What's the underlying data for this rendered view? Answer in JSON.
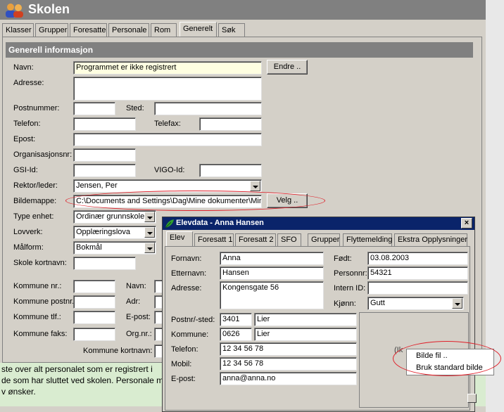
{
  "app": {
    "title": "Skolen",
    "tabs": [
      "Klasser",
      "Grupper",
      "Foresatte",
      "Personale",
      "Rom",
      "Generelt",
      "Søk"
    ],
    "active_tab": "Generelt"
  },
  "section_title": "Generell informasjon",
  "form": {
    "navn_label": "Navn:",
    "navn_value": "Programmet er ikke registrert",
    "endre_label": "Endre ..",
    "adresse_label": "Adresse:",
    "postnummer_label": "Postnummer:",
    "sted_label": "Sted:",
    "telefon_label": "Telefon:",
    "telefax_label": "Telefax:",
    "epost_label": "Epost:",
    "orgnr_label": "Organisasjonsnr:",
    "gsi_label": "GSI-Id:",
    "vigo_label": "VIGO-Id:",
    "rektor_label": "Rektor/leder:",
    "rektor_value": "Jensen, Per",
    "bildemappe_label": "Bildemappe:",
    "bildemappe_value": "C:\\Documents and Settings\\Dag\\Mine dokumenter\\Min",
    "velg_label": "Velg ..",
    "type_label": "Type enhet:",
    "type_value": "Ordinær grunnskole",
    "lovverk_label": "Lovverk:",
    "lovverk_value": "Opplæringslova",
    "malform_label": "Målform:",
    "malform_value": "Bokmål",
    "skole_kortnavn_label": "Skole kortnavn:",
    "kommune_nr_label": "Kommune nr.:",
    "navn2_label": "Navn:",
    "kommune_postnr_label": "Kommune postnr.:",
    "adr_label": "Adr:",
    "kommune_tlf_label": "Kommune tlf.:",
    "epost2_label": "E-post:",
    "kommune_faks_label": "Kommune faks:",
    "orgnr2_label": "Org.nr.:",
    "kommune_kortnavn_label": "Kommune kortnavn:"
  },
  "status": {
    "line1": "ste over alt personalet som er registrert i",
    "line2": "de som har sluttet ved skolen. Personale må legges inn med initialer. I Kode-feltet kan du legge inn ansattnr. eller",
    "line3": "v ønsker."
  },
  "dialog": {
    "title": "Elevdata - Anna Hansen",
    "tabs": [
      "Elev",
      "Foresatt 1",
      "Foresatt 2",
      "SFO",
      "Grupper",
      "Flyttemelding",
      "Ekstra Opplysninger"
    ],
    "active_tab": "Elev",
    "fornavn_label": "Fornavn:",
    "fornavn_value": "Anna",
    "etternavn_label": "Etternavn:",
    "etternavn_value": "Hansen",
    "adresse_label": "Adresse:",
    "adresse_value": "Kongensgate 56",
    "postnr_label": "Postnr/-sted:",
    "postnr_value": "3401",
    "sted_value": "Lier",
    "kommune_label": "Kommune:",
    "kommune_nr_value": "0626",
    "kommune_value": "Lier",
    "telefon_label": "Telefon:",
    "telefon_value": "12 34 56 78",
    "mobil_label": "Mobil:",
    "mobil_value": "12 34 56 78",
    "epost_label": "E-post:",
    "epost_value": "anna@anna.no",
    "fodt_label": "Født:",
    "fodt_value": "03.08.2003",
    "personnr_label": "Personnr:",
    "personnr_value": "54321",
    "intern_label": "Intern ID:",
    "kjonn_label": "Kjønn:",
    "kjonn_value": "Gutt",
    "photo_caption": "(Ik"
  },
  "context_menu": {
    "items": [
      "Bilde fil ..",
      "Bruk standard bilde"
    ]
  },
  "colors": {
    "window_bg": "#d4d0c8",
    "titlebar": "#808080",
    "dialog_titlebar": "#0a246a",
    "yellow_field": "#ffffe1",
    "status_bg": "#d9ecd0",
    "annotation_red": "#e0202a"
  }
}
